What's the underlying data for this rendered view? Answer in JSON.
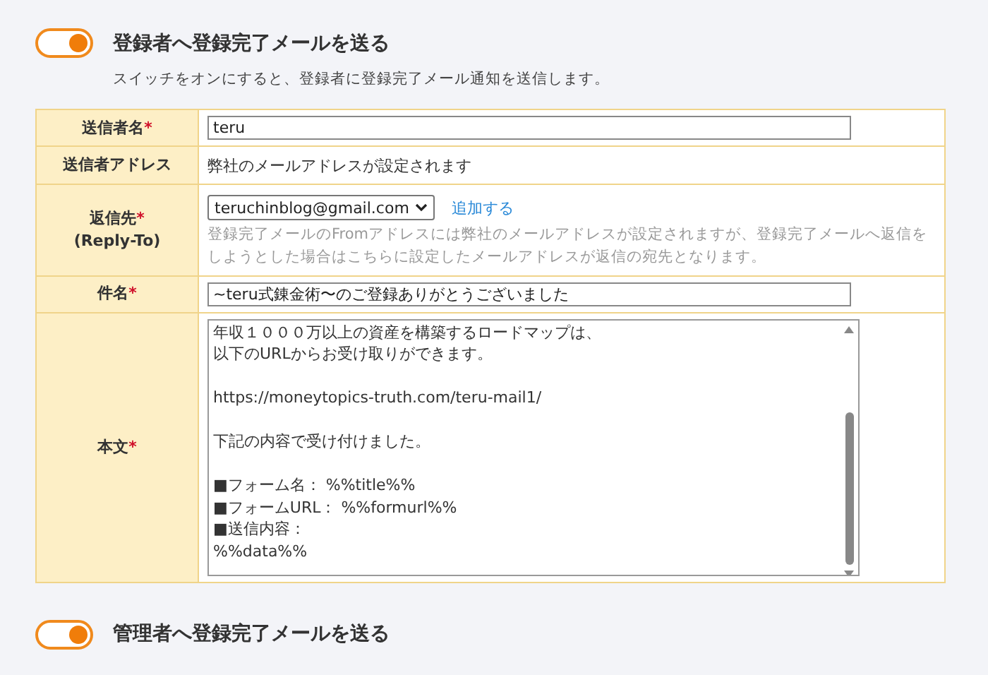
{
  "sections": [
    {
      "toggle": {
        "on": true
      },
      "title": "登録者へ登録完了メールを送る",
      "description": "スイッチをオンにすると、登録者に登録完了メール通知を送信します。",
      "rows": [
        {
          "kind": "input",
          "label": "送信者名",
          "required_mark": "*",
          "value": "teru"
        },
        {
          "kind": "text",
          "label": "送信者アドレス",
          "value": "弊社のメールアドレスが設定されます"
        },
        {
          "kind": "select",
          "label": "返信先",
          "required_mark": "*",
          "sublabel": "(Reply-To)",
          "value": "teruchinblog@gmail.com",
          "link": "追加する",
          "help": "登録完了メールのFromアドレスには弊社のメールアドレスが設定されますが、登録完了メールへ返信をしようとした場合はこちらに設定したメールアドレスが返信の宛先となります。"
        },
        {
          "kind": "input",
          "label": "件名",
          "required_mark": "*",
          "value": "~teru式錬金術〜のご登録ありがとうございました"
        },
        {
          "kind": "textarea",
          "label": "本文",
          "required_mark": "*",
          "paragraphs": [
            [
              "年収１０００万以上の資産を構築するロードマップは、",
              "以下のURLからお受け取りができます。"
            ],
            [
              "https://moneytopics-truth.com/teru-mail1/"
            ],
            [
              "下記の内容で受け付けました。"
            ],
            [
              "■フォーム名： %%title%%",
              "■フォームURL： %%formurl%%",
              "■送信内容：",
              "%%data%%"
            ]
          ]
        }
      ]
    },
    {
      "toggle": {
        "on": true
      },
      "title": "管理者へ登録完了メールを送る"
    }
  ]
}
